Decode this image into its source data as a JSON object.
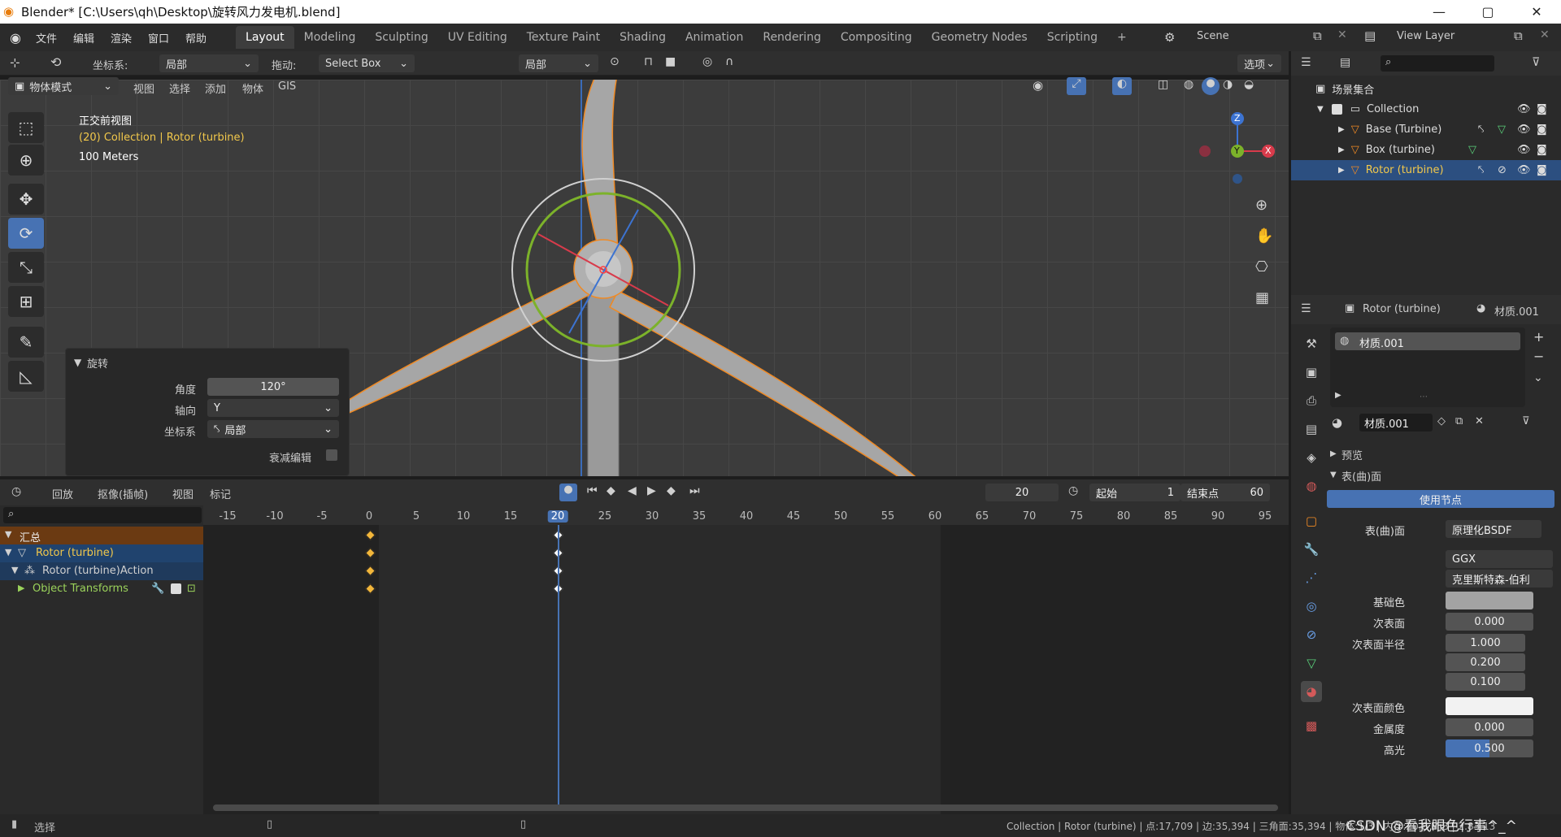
{
  "window": {
    "title": "Blender* [C:\\Users\\qh\\Desktop\\旋转风力发电机.blend]",
    "min": "—",
    "max": "▢",
    "close": "✕"
  },
  "menu": [
    "文件",
    "编辑",
    "渲染",
    "窗口",
    "帮助"
  ],
  "workspaces": [
    "Layout",
    "Modeling",
    "Sculpting",
    "UV Editing",
    "Texture Paint",
    "Shading",
    "Animation",
    "Rendering",
    "Compositing",
    "Geometry Nodes",
    "Scripting",
    "+"
  ],
  "scene": "Scene",
  "view_layer": "View Layer",
  "vp_header": {
    "coord_label": "坐标系:",
    "coord_value": "局部",
    "drag_label": "拖动:",
    "drag_value": "Select Box",
    "pivot_value": "局部",
    "options": "选项"
  },
  "vp_header2": {
    "mode": "物体模式",
    "view": "视图",
    "select": "选择",
    "add": "添加",
    "object": "物体",
    "gis": "GIS"
  },
  "overlay_text": {
    "view_name": "正交前视图",
    "collection": "(20) Collection | Rotor (turbine)",
    "scale": "100 Meters"
  },
  "gizmo": {
    "z": "Z",
    "y": "Y",
    "x": "X"
  },
  "redo_panel": {
    "title": "旋转",
    "angle_label": "角度",
    "angle_value": "120°",
    "axis_label": "轴向",
    "axis_value": "Y",
    "coord_label": "坐标系",
    "coord_value": "局部",
    "prop_edit": "衰减编辑"
  },
  "timeline_hdr": {
    "playback": "回放",
    "keying": "抠像(插帧)",
    "view": "视图",
    "marker": "标记",
    "frame": "20",
    "start_label": "起始",
    "start": "1",
    "end_label": "结束点",
    "end": "60"
  },
  "timeline_ticks": [
    "-15",
    "-10",
    "-5",
    "0",
    "5",
    "10",
    "15",
    "20",
    "25",
    "30",
    "35",
    "40",
    "45",
    "50",
    "55",
    "60",
    "65",
    "70",
    "75",
    "80",
    "85",
    "90",
    "95"
  ],
  "timeline_channels": {
    "summary": "汇总",
    "rotor": "Rotor (turbine)",
    "action": "Rotor (turbine)Action",
    "transforms": "Object Transforms"
  },
  "outliner": {
    "scene_collection": "场景集合",
    "collection": "Collection",
    "items": [
      "Base (Turbine)",
      "Box (turbine)",
      "Rotor (turbine)"
    ]
  },
  "props": {
    "object": "Rotor (turbine)",
    "material": "材质.001",
    "slot": "材质.001",
    "mat_field": "材质.001",
    "preview": "预览",
    "surface": "表(曲)面",
    "use_nodes": "使用节点",
    "rows": [
      {
        "label": "表(曲)面",
        "value": "原理化BSDF"
      },
      {
        "label": "",
        "value": "GGX"
      },
      {
        "label": "",
        "value": "克里斯特森-伯利"
      },
      {
        "label": "基础色",
        "value": ""
      },
      {
        "label": "次表面",
        "value": "0.000"
      },
      {
        "label": "次表面半径",
        "value": "1.000"
      },
      {
        "label": "",
        "value": "0.200"
      },
      {
        "label": "",
        "value": "0.100"
      },
      {
        "label": "次表面颜色",
        "value": ""
      },
      {
        "label": "金属度",
        "value": "0.000"
      },
      {
        "label": "高光",
        "value": "0.500"
      }
    ]
  },
  "status": {
    "left": "选择",
    "right": "Collection | Rotor (turbine) | 点:17,709 | 边:35,394 | 三角面:35,394 | 物体:1/3 | 内存:20.8 MiB | 2.83.13",
    "watermark": "CSDN @看我眼色行事^_^"
  },
  "colors": {
    "accent": "#4772b3",
    "keyframe": "#f2b63a",
    "selected_orange": "#f08a24"
  }
}
